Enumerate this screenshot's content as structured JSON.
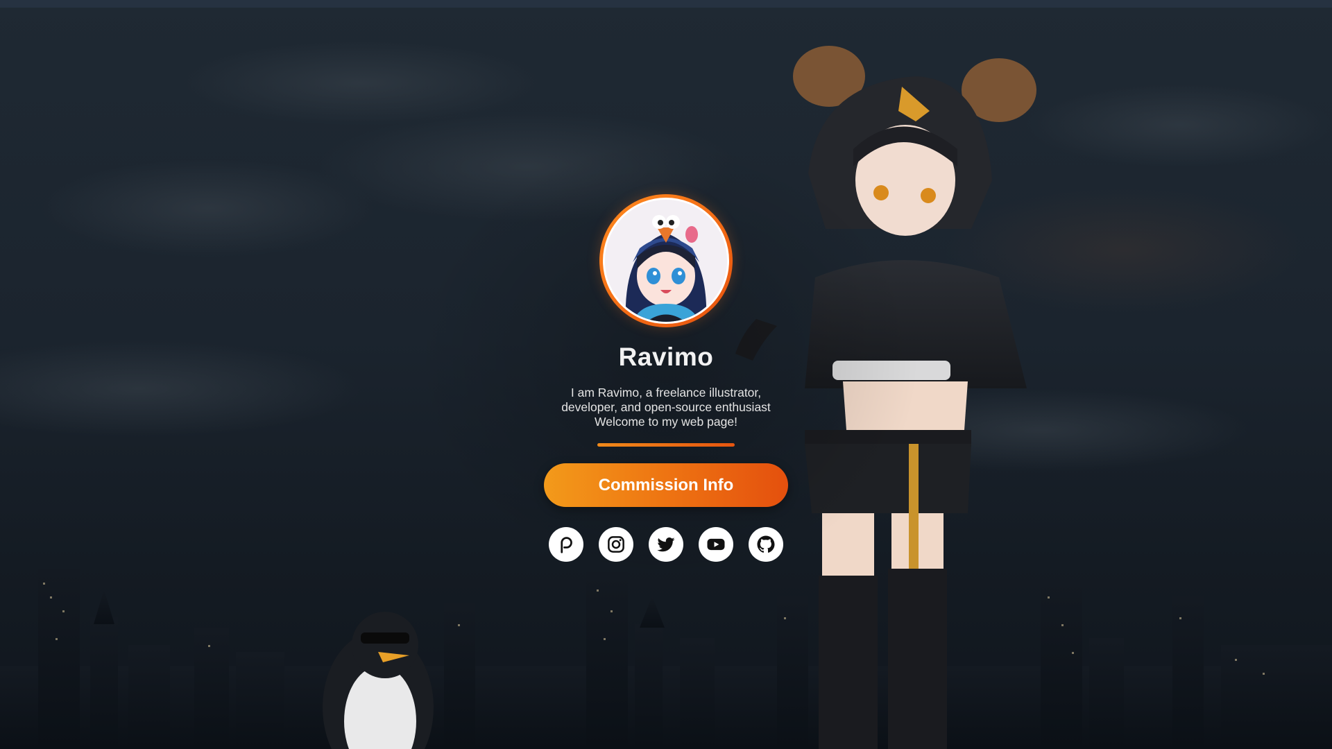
{
  "profile": {
    "name": "Ravimo",
    "bio": {
      "line1": "I am Ravimo, a freelance illustrator,",
      "line2": "developer, and open-source enthusiast",
      "line3": "Welcome to my web page!"
    },
    "avatar_alt": "Ravimo avatar"
  },
  "cta": {
    "label": "Commission Info"
  },
  "socials": [
    {
      "name": "patreon",
      "icon": "patreon-icon"
    },
    {
      "name": "instagram",
      "icon": "instagram-icon"
    },
    {
      "name": "twitter",
      "icon": "twitter-icon"
    },
    {
      "name": "youtube",
      "icon": "youtube-icon"
    },
    {
      "name": "github",
      "icon": "github-icon"
    }
  ],
  "colors": {
    "accent_start": "#f39a1a",
    "accent_end": "#e4500e",
    "background": "#1b242e",
    "text": "#f2f2f2"
  }
}
